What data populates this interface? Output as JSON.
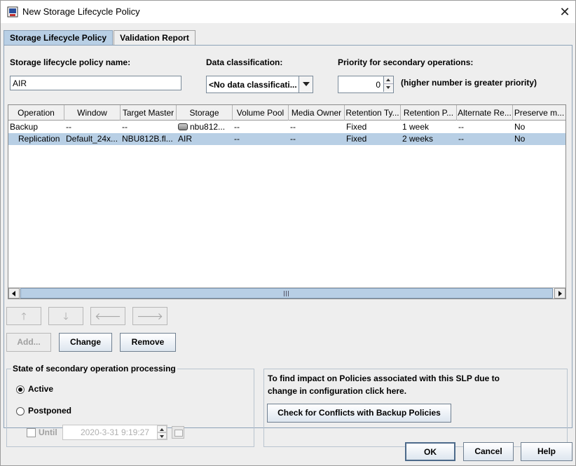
{
  "window": {
    "title": "New Storage Lifecycle Policy",
    "close_symbol": "✕"
  },
  "tabs": [
    {
      "label": "Storage Lifecycle Policy",
      "active": true
    },
    {
      "label": "Validation Report",
      "active": false
    }
  ],
  "form": {
    "policy_name_label": "Storage lifecycle policy name:",
    "policy_name_value": "AIR",
    "data_classification_label": "Data classification:",
    "data_classification_value": "<No data classificati...",
    "priority_label": "Priority for secondary operations:",
    "priority_value": "0",
    "priority_hint": "(higher number is greater priority)"
  },
  "table": {
    "columns": [
      "Operation",
      "Window",
      "Target Master",
      "Storage",
      "Volume Pool",
      "Media Owner",
      "Retention Ty...",
      "Retention P...",
      "Alternate Re...",
      "Preserve m..."
    ],
    "rows": [
      {
        "operation": "Backup",
        "window": "--",
        "target_master": "--",
        "storage": "nbu812...",
        "volume_pool": "--",
        "media_owner": "--",
        "retention_type": "Fixed",
        "retention_period": "1 week",
        "alternate_read": "--",
        "preserve": "No",
        "selected": false
      },
      {
        "operation": "Replication",
        "window": "Default_24x...",
        "target_master": "NBU812B.fl...",
        "storage": "AIR",
        "volume_pool": "--",
        "media_owner": "--",
        "retention_type": "Fixed",
        "retention_period": "2 weeks",
        "alternate_read": "--",
        "preserve": "No",
        "selected": true
      }
    ]
  },
  "move_buttons": {
    "up": "🡑",
    "down": "🡓",
    "left": "🡐",
    "right": "🡒"
  },
  "actions": {
    "add": "Add...",
    "change": "Change",
    "remove": "Remove"
  },
  "state_group": {
    "title": "State of secondary operation processing",
    "active_label": "Active",
    "postponed_label": "Postponed",
    "until_label": "Until",
    "until_value": "2020-3-31 9:19:27",
    "selected": "Active"
  },
  "conflicts": {
    "info_line1": "To find impact on Policies associated with this SLP due to",
    "info_line2": "change in configuration click here.",
    "button": "Check for Conflicts with Backup Policies"
  },
  "footer": {
    "ok": "OK",
    "cancel": "Cancel",
    "help": "Help"
  },
  "colors": {
    "accent": "#b8cfe5",
    "panel_bg": "#eeeeee"
  }
}
